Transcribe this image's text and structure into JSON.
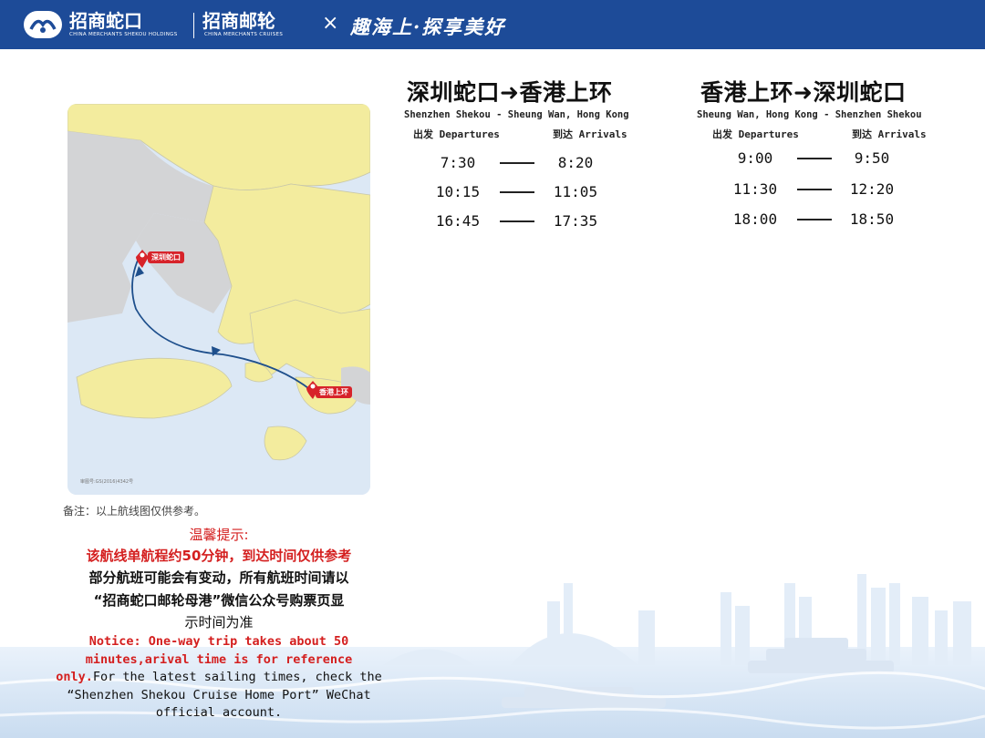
{
  "header": {
    "brand1": "招商蛇口",
    "brand1_en": "CHINA MERCHANTS SHEKOU HOLDINGS",
    "brand2": "招商邮轮",
    "brand2_en": "CHINA MERCHANTS CRUISES",
    "separator": "×",
    "slogan": "趣海上·探享美好"
  },
  "map": {
    "pin_shekou": "深圳蛇口",
    "pin_sheungwan": "香港上环",
    "map_number": "审图号:GS(2016)4342号"
  },
  "routes": [
    {
      "title": "深圳蛇口➜香港上环",
      "subtitle": "Shenzhen Shekou -  Sheung Wan, Hong Kong",
      "departures_label": "出发 Departures",
      "arrivals_label": "到达 Arrivals",
      "rows": [
        {
          "dep": "7:30",
          "arr": "8:20"
        },
        {
          "dep": "10:15",
          "arr": "11:05"
        },
        {
          "dep": "16:45",
          "arr": "17:35"
        }
      ]
    },
    {
      "title": "香港上环➜深圳蛇口",
      "subtitle": "Sheung Wan, Hong Kong  -  Shenzhen Shekou",
      "departures_label": "出发 Departures",
      "arrivals_label": "到达 Arrivals",
      "rows": [
        {
          "dep": "9:00",
          "arr": "9:50"
        },
        {
          "dep": "11:30",
          "arr": "12:20"
        },
        {
          "dep": "18:00",
          "arr": "18:50"
        }
      ]
    }
  ],
  "notes": {
    "remark": "备注：以上航线图仅供参考。",
    "tip_title": "温馨提示:",
    "line1": "该航线单航程约50分钟，到达时间仅供参考",
    "line2": "部分航班可能会有变动，所有航班时间请以",
    "line3": "“招商蛇口邮轮母港”微信公众号购票页显",
    "line4": "示时间为准",
    "en_red": "Notice: One-way trip takes about 50 minutes,arival time is for reference only.",
    "en_black": "For the latest sailing times, check the “Shenzhen Shekou Cruise Home Port” WeChat official account."
  },
  "colors": {
    "header_bg": "#1d4b98",
    "notice_red": "#d41f1f",
    "land": "#f3ec9e",
    "route_line": "#1e4f8c"
  }
}
